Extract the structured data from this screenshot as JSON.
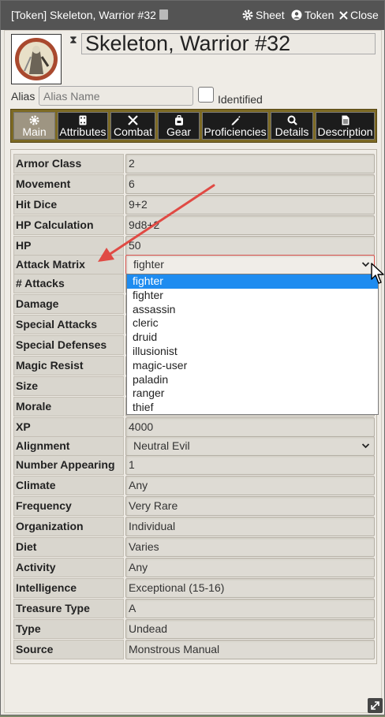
{
  "window": {
    "title": "[Token] Skeleton, Warrior #32",
    "buttons": {
      "sheet": "Sheet",
      "token": "Token",
      "close": "Close"
    }
  },
  "header": {
    "name": "Skeleton, Warrior #32",
    "alias_label": "Alias",
    "alias_placeholder": "Alias Name",
    "identified_label": "Identified"
  },
  "tabs": [
    {
      "label": "Main",
      "icon": "gear-icon",
      "active": true
    },
    {
      "label": "Attributes",
      "icon": "dice-icon"
    },
    {
      "label": "Combat",
      "icon": "swords-icon"
    },
    {
      "label": "Gear",
      "icon": "backpack-icon"
    },
    {
      "label": "Proficiencies",
      "icon": "pencil-icon"
    },
    {
      "label": "Details",
      "icon": "search-icon"
    },
    {
      "label": "Description",
      "icon": "document-icon"
    }
  ],
  "rows": [
    {
      "label": "Armor Class",
      "value": "2"
    },
    {
      "label": "Movement",
      "value": "6"
    },
    {
      "label": "Hit Dice",
      "value": "9+2"
    },
    {
      "label": "HP Calculation",
      "value": "9d8+2"
    },
    {
      "label": "HP",
      "value": "50"
    },
    {
      "label": "Attack Matrix",
      "value": "fighter"
    },
    {
      "label": "# Attacks",
      "value": ""
    },
    {
      "label": "Damage",
      "value": ""
    },
    {
      "label": "Special Attacks",
      "value": ""
    },
    {
      "label": "Special Defenses",
      "value": ""
    },
    {
      "label": "Magic Resist",
      "value": ""
    },
    {
      "label": "Size",
      "value": ""
    },
    {
      "label": "Morale",
      "value": ""
    },
    {
      "label": "XP",
      "value": "4000"
    },
    {
      "label": "Alignment",
      "value": "Neutral Evil"
    },
    {
      "label": "Number Appearing",
      "value": "1"
    },
    {
      "label": "Climate",
      "value": "Any"
    },
    {
      "label": "Frequency",
      "value": "Very Rare"
    },
    {
      "label": "Organization",
      "value": "Individual"
    },
    {
      "label": "Diet",
      "value": "Varies"
    },
    {
      "label": "Activity",
      "value": "Any"
    },
    {
      "label": "Intelligence",
      "value": "Exceptional (15-16)"
    },
    {
      "label": "Treasure Type",
      "value": "A"
    },
    {
      "label": "Type",
      "value": "Undead"
    },
    {
      "label": "Source",
      "value": "Monstrous Manual"
    }
  ],
  "attack_matrix_options": [
    "fighter",
    "fighter",
    "assassin",
    "cleric",
    "druid",
    "illusionist",
    "magic-user",
    "paladin",
    "ranger",
    "thief"
  ],
  "colors": {
    "highlight": "#1e8cf0",
    "titlebar": "#545454",
    "tabbar": "#7d6a24",
    "arrow": "#e04a44"
  }
}
